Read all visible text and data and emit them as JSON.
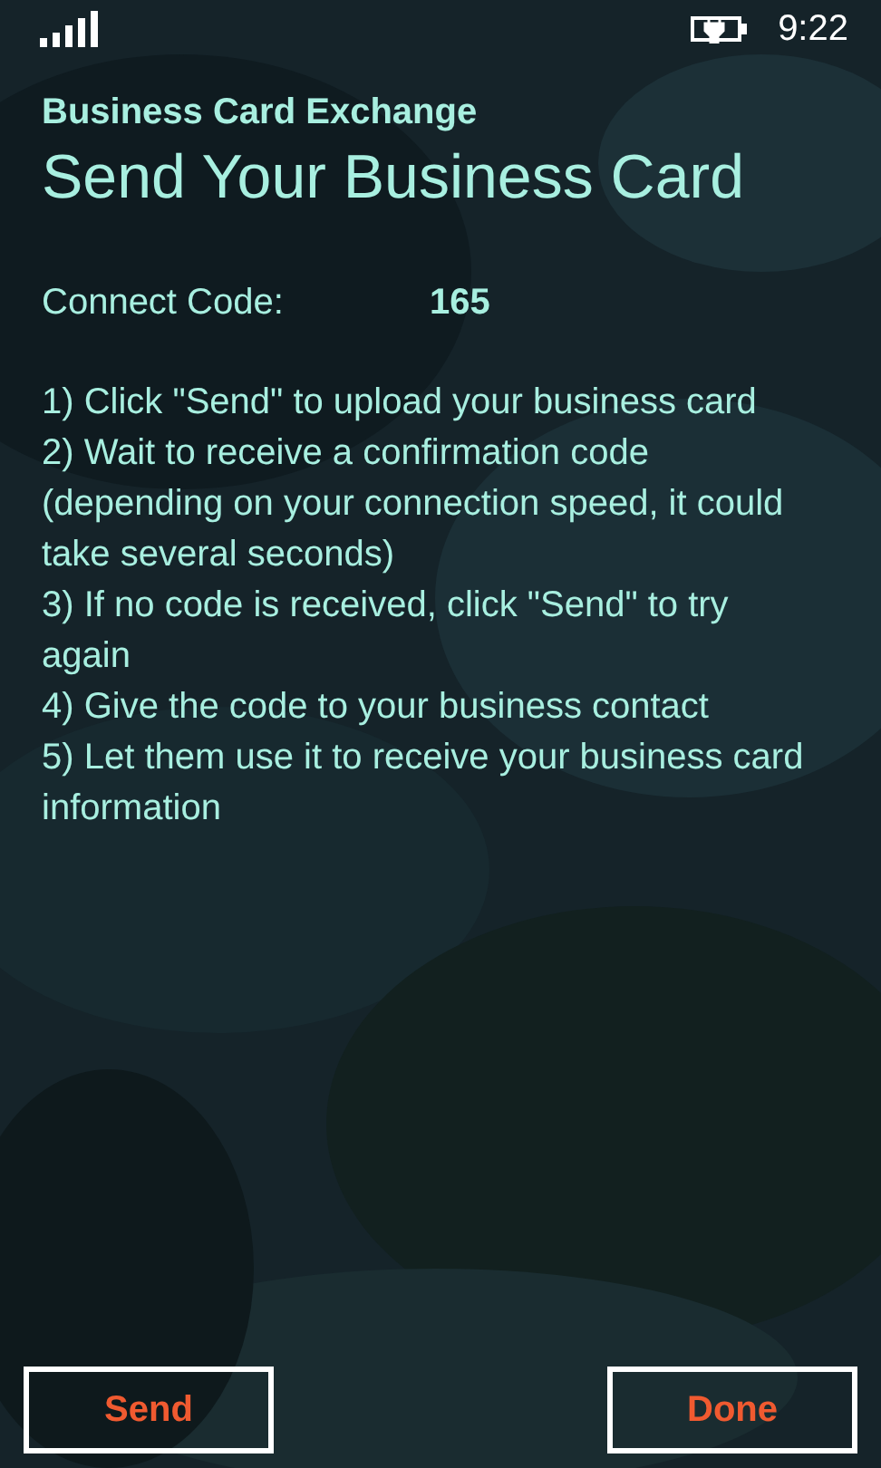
{
  "status_bar": {
    "time": "9:22"
  },
  "app_title": "Business Card Exchange",
  "page_title": "Send Your Business Card",
  "connect_code": {
    "label": "Connect Code:",
    "value": "165"
  },
  "instructions": [
    "1) Click \"Send\" to upload your business card",
    "2) Wait to receive a confirmation code (depending on your connection speed, it could take several seconds)",
    "3) If no code is received, click \"Send\" to try again",
    "4) Give the code to your business contact",
    "5) Let them use it to receive your business card information"
  ],
  "buttons": [
    "Send",
    "Done"
  ]
}
